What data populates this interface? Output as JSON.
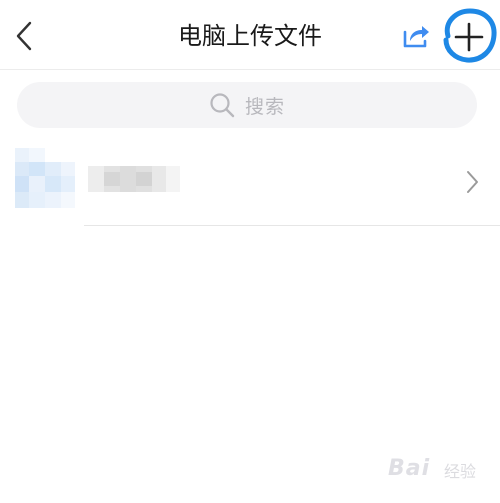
{
  "header": {
    "title": "电脑上传文件",
    "back_icon": "chevron-left-icon",
    "share_icon": "share-icon",
    "add_icon": "plus-icon",
    "accent_color": "#3f8cf0",
    "highlight_color": "#1e88e5"
  },
  "search": {
    "placeholder": "搜索",
    "icon": "search-icon"
  },
  "list": {
    "items": [
      {
        "name": "",
        "icon": "folder-icon",
        "chevron": "chevron-right-icon"
      }
    ]
  },
  "watermark": {
    "text": "Bai",
    "sub": "经验"
  }
}
